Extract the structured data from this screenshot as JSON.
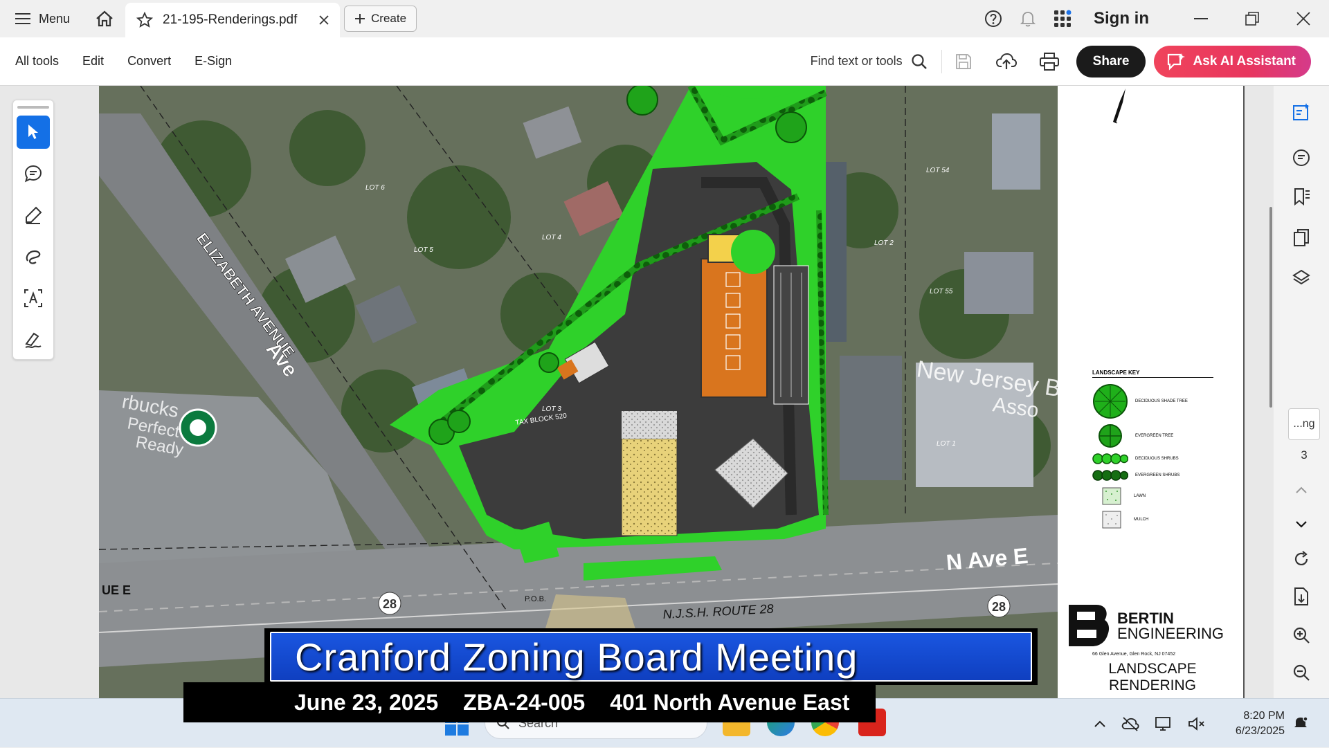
{
  "titlebar": {
    "menu_label": "Menu",
    "tab_title": "21-195-Renderings.pdf",
    "create_label": "Create",
    "sign_in_label": "Sign in"
  },
  "toolbar": {
    "items": [
      "All tools",
      "Edit",
      "Convert",
      "E-Sign"
    ],
    "find_label": "Find text or tools",
    "share_label": "Share",
    "ai_label": "Ask AI Assistant"
  },
  "document": {
    "street_labels": {
      "elizabeth": "ELIZABETH AVENUE",
      "ave": "Ave",
      "n_ave_e": "N Ave E",
      "route": "N.J.S.H. ROUTE 28",
      "ue_e": "UE E",
      "new_jersey": "New Jersey B",
      "asso": "Asso",
      "starbucks": "rbucks",
      "perfect": "Perfect",
      "ready": "Ready",
      "route_shield": "28",
      "tax_block": "TAX BLOCK 520",
      "pob": "P.O.B."
    },
    "lot_labels": [
      "LOT 4",
      "LOT 3",
      "LOT 2",
      "LOT 1",
      "LOT 5",
      "LOT 6",
      "LOT 54",
      "LOT 55"
    ],
    "legend": {
      "title": "LANDSCAPE KEY",
      "items": [
        "DECIDUOUS SHADE TREE",
        "EVERGREEN TREE",
        "DECIDUOUS SHRUBS",
        "EVERGREEN SHRUBS",
        "LAWN",
        "MULCH"
      ]
    },
    "firm": {
      "name_line1": "BERTIN",
      "name_line2": "ENGINEERING",
      "address": "66 Glen Avenue, Glen Rock, NJ 07452",
      "sheet_line1": "LANDSCAPE",
      "sheet_line2": "RENDERING"
    }
  },
  "page_nav": {
    "current_field": "...ng",
    "total": "3"
  },
  "banner": {
    "title": "Cranford Zoning Board Meeting",
    "date": "June 23, 2025",
    "case": "ZBA-24-005",
    "address": "401 North Avenue East"
  },
  "taskbar": {
    "search_placeholder": "Search",
    "time": "8:20 PM",
    "date": "6/23/2025"
  },
  "colors": {
    "accent_blue": "#1470e6",
    "ai_button": "#e8365e",
    "lawn_green": "#2fd12a",
    "banner_blue": "#1a56e0"
  }
}
